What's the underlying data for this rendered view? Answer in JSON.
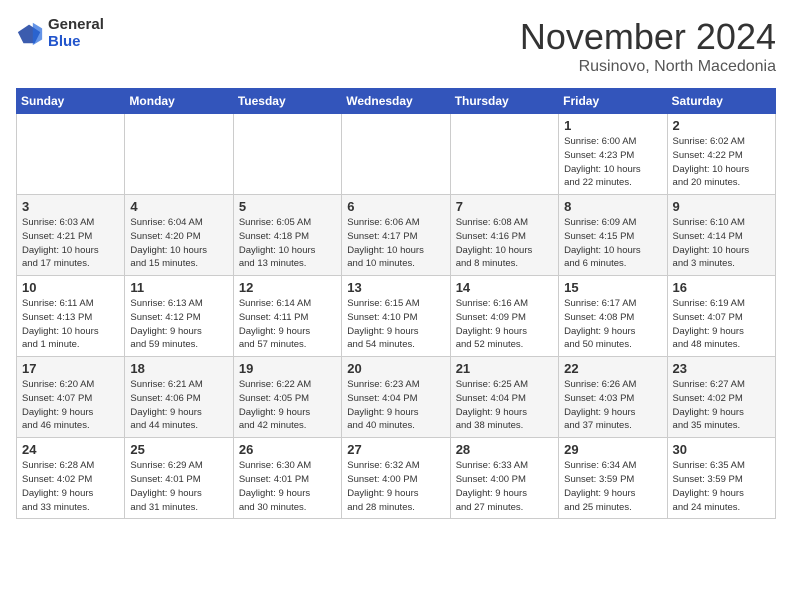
{
  "header": {
    "logo_general": "General",
    "logo_blue": "Blue",
    "month": "November 2024",
    "location": "Rusinovo, North Macedonia"
  },
  "days_of_week": [
    "Sunday",
    "Monday",
    "Tuesday",
    "Wednesday",
    "Thursday",
    "Friday",
    "Saturday"
  ],
  "weeks": [
    [
      {
        "day": "",
        "detail": ""
      },
      {
        "day": "",
        "detail": ""
      },
      {
        "day": "",
        "detail": ""
      },
      {
        "day": "",
        "detail": ""
      },
      {
        "day": "",
        "detail": ""
      },
      {
        "day": "1",
        "detail": "Sunrise: 6:00 AM\nSunset: 4:23 PM\nDaylight: 10 hours\nand 22 minutes."
      },
      {
        "day": "2",
        "detail": "Sunrise: 6:02 AM\nSunset: 4:22 PM\nDaylight: 10 hours\nand 20 minutes."
      }
    ],
    [
      {
        "day": "3",
        "detail": "Sunrise: 6:03 AM\nSunset: 4:21 PM\nDaylight: 10 hours\nand 17 minutes."
      },
      {
        "day": "4",
        "detail": "Sunrise: 6:04 AM\nSunset: 4:20 PM\nDaylight: 10 hours\nand 15 minutes."
      },
      {
        "day": "5",
        "detail": "Sunrise: 6:05 AM\nSunset: 4:18 PM\nDaylight: 10 hours\nand 13 minutes."
      },
      {
        "day": "6",
        "detail": "Sunrise: 6:06 AM\nSunset: 4:17 PM\nDaylight: 10 hours\nand 10 minutes."
      },
      {
        "day": "7",
        "detail": "Sunrise: 6:08 AM\nSunset: 4:16 PM\nDaylight: 10 hours\nand 8 minutes."
      },
      {
        "day": "8",
        "detail": "Sunrise: 6:09 AM\nSunset: 4:15 PM\nDaylight: 10 hours\nand 6 minutes."
      },
      {
        "day": "9",
        "detail": "Sunrise: 6:10 AM\nSunset: 4:14 PM\nDaylight: 10 hours\nand 3 minutes."
      }
    ],
    [
      {
        "day": "10",
        "detail": "Sunrise: 6:11 AM\nSunset: 4:13 PM\nDaylight: 10 hours\nand 1 minute."
      },
      {
        "day": "11",
        "detail": "Sunrise: 6:13 AM\nSunset: 4:12 PM\nDaylight: 9 hours\nand 59 minutes."
      },
      {
        "day": "12",
        "detail": "Sunrise: 6:14 AM\nSunset: 4:11 PM\nDaylight: 9 hours\nand 57 minutes."
      },
      {
        "day": "13",
        "detail": "Sunrise: 6:15 AM\nSunset: 4:10 PM\nDaylight: 9 hours\nand 54 minutes."
      },
      {
        "day": "14",
        "detail": "Sunrise: 6:16 AM\nSunset: 4:09 PM\nDaylight: 9 hours\nand 52 minutes."
      },
      {
        "day": "15",
        "detail": "Sunrise: 6:17 AM\nSunset: 4:08 PM\nDaylight: 9 hours\nand 50 minutes."
      },
      {
        "day": "16",
        "detail": "Sunrise: 6:19 AM\nSunset: 4:07 PM\nDaylight: 9 hours\nand 48 minutes."
      }
    ],
    [
      {
        "day": "17",
        "detail": "Sunrise: 6:20 AM\nSunset: 4:07 PM\nDaylight: 9 hours\nand 46 minutes."
      },
      {
        "day": "18",
        "detail": "Sunrise: 6:21 AM\nSunset: 4:06 PM\nDaylight: 9 hours\nand 44 minutes."
      },
      {
        "day": "19",
        "detail": "Sunrise: 6:22 AM\nSunset: 4:05 PM\nDaylight: 9 hours\nand 42 minutes."
      },
      {
        "day": "20",
        "detail": "Sunrise: 6:23 AM\nSunset: 4:04 PM\nDaylight: 9 hours\nand 40 minutes."
      },
      {
        "day": "21",
        "detail": "Sunrise: 6:25 AM\nSunset: 4:04 PM\nDaylight: 9 hours\nand 38 minutes."
      },
      {
        "day": "22",
        "detail": "Sunrise: 6:26 AM\nSunset: 4:03 PM\nDaylight: 9 hours\nand 37 minutes."
      },
      {
        "day": "23",
        "detail": "Sunrise: 6:27 AM\nSunset: 4:02 PM\nDaylight: 9 hours\nand 35 minutes."
      }
    ],
    [
      {
        "day": "24",
        "detail": "Sunrise: 6:28 AM\nSunset: 4:02 PM\nDaylight: 9 hours\nand 33 minutes."
      },
      {
        "day": "25",
        "detail": "Sunrise: 6:29 AM\nSunset: 4:01 PM\nDaylight: 9 hours\nand 31 minutes."
      },
      {
        "day": "26",
        "detail": "Sunrise: 6:30 AM\nSunset: 4:01 PM\nDaylight: 9 hours\nand 30 minutes."
      },
      {
        "day": "27",
        "detail": "Sunrise: 6:32 AM\nSunset: 4:00 PM\nDaylight: 9 hours\nand 28 minutes."
      },
      {
        "day": "28",
        "detail": "Sunrise: 6:33 AM\nSunset: 4:00 PM\nDaylight: 9 hours\nand 27 minutes."
      },
      {
        "day": "29",
        "detail": "Sunrise: 6:34 AM\nSunset: 3:59 PM\nDaylight: 9 hours\nand 25 minutes."
      },
      {
        "day": "30",
        "detail": "Sunrise: 6:35 AM\nSunset: 3:59 PM\nDaylight: 9 hours\nand 24 minutes."
      }
    ]
  ]
}
